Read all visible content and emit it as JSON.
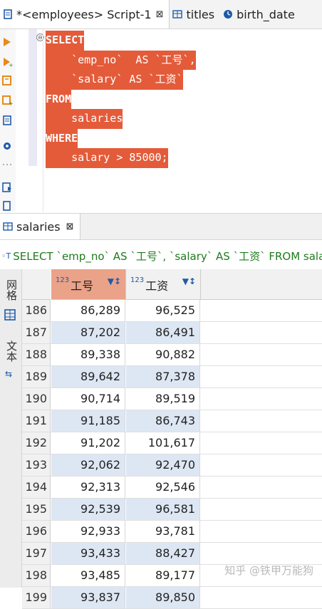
{
  "tabs": [
    {
      "label": "*<employees> Script-1",
      "close": "⊠",
      "active": true
    },
    {
      "label": "titles",
      "active": false
    },
    {
      "label": "birth_date",
      "active": false
    }
  ],
  "editor": {
    "lines": [
      {
        "kw": "SELECT",
        "text": ""
      },
      {
        "kw": "",
        "text": "    `emp_no`  AS `工号`,"
      },
      {
        "kw": "",
        "text": "    `salary` AS `工资`"
      },
      {
        "kw": "FROM",
        "text": ""
      },
      {
        "kw": "",
        "text": "    salaries"
      },
      {
        "kw": "WHERE",
        "text": ""
      },
      {
        "kw": "",
        "text": "    salary > 85000;"
      }
    ],
    "selection_color": "#e45b3a"
  },
  "results": {
    "tab_label": "salaries",
    "tab_close": "⊠",
    "query": "SELECT `emp_no` AS `工号`, `salary` AS `工资` FROM salar",
    "sidebar": {
      "grid_label": "网格",
      "text_label": "文本"
    },
    "columns": [
      {
        "type_badge": "123",
        "name": "工号",
        "highlight": "#eaa288"
      },
      {
        "type_badge": "123",
        "name": "工资"
      }
    ],
    "rows": [
      {
        "n": "186",
        "a": "86,289",
        "b": "96,525"
      },
      {
        "n": "187",
        "a": "87,202",
        "b": "86,491"
      },
      {
        "n": "188",
        "a": "89,338",
        "b": "90,882"
      },
      {
        "n": "189",
        "a": "89,642",
        "b": "87,378"
      },
      {
        "n": "190",
        "a": "90,714",
        "b": "89,519"
      },
      {
        "n": "191",
        "a": "91,185",
        "b": "86,743"
      },
      {
        "n": "192",
        "a": "91,202",
        "b": "101,617"
      },
      {
        "n": "193",
        "a": "92,062",
        "b": "92,470"
      },
      {
        "n": "194",
        "a": "92,313",
        "b": "92,546"
      },
      {
        "n": "195",
        "a": "92,539",
        "b": "96,581"
      },
      {
        "n": "196",
        "a": "92,933",
        "b": "93,781"
      },
      {
        "n": "197",
        "a": "93,433",
        "b": "88,427"
      },
      {
        "n": "198",
        "a": "93,485",
        "b": "89,177"
      },
      {
        "n": "199",
        "a": "93,837",
        "b": "89,850"
      }
    ]
  },
  "watermark": "知乎 @铁甲万能狗"
}
